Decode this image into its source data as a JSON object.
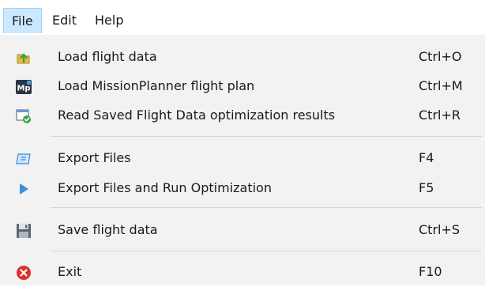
{
  "menubar": {
    "items": [
      {
        "label": "File",
        "active": true
      },
      {
        "label": "Edit",
        "active": false
      },
      {
        "label": "Help",
        "active": false
      }
    ]
  },
  "file_menu": {
    "items": [
      {
        "label": "Load flight data",
        "shortcut": "Ctrl+O",
        "icon": "folder-up-icon"
      },
      {
        "label": "Load MissionPlanner flight plan",
        "shortcut": "Ctrl+M",
        "icon": "missionplanner-icon"
      },
      {
        "label": "Read Saved Flight Data optimization results",
        "shortcut": "Ctrl+R",
        "icon": "window-check-icon"
      },
      {
        "label": "Export Files",
        "shortcut": "F4",
        "icon": "export-icon"
      },
      {
        "label": "Export Files and Run Optimization",
        "shortcut": "F5",
        "icon": "play-icon"
      },
      {
        "label": "Save flight data",
        "shortcut": "Ctrl+S",
        "icon": "floppy-disk-icon"
      },
      {
        "label": "Exit",
        "shortcut": "F10",
        "icon": "close-circle-icon"
      }
    ]
  },
  "colors": {
    "menu_active_bg": "#cce8ff",
    "menu_active_border": "#99d1ff",
    "dropdown_bg": "#f2f2f2",
    "separator": "#d6d6d6"
  }
}
